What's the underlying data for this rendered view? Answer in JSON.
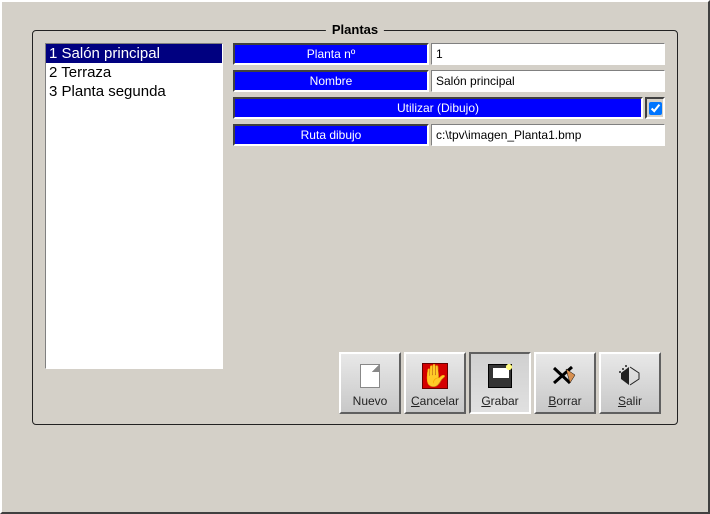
{
  "window": {
    "title": "Plantas"
  },
  "list": {
    "items": [
      {
        "label": "1 Salón principal",
        "selected": true
      },
      {
        "label": "2 Terraza",
        "selected": false
      },
      {
        "label": "3 Planta segunda",
        "selected": false
      }
    ]
  },
  "form": {
    "planta_no": {
      "label": "Planta nº",
      "value": "1"
    },
    "nombre": {
      "label": "Nombre",
      "value": "Salón principal"
    },
    "utilizar": {
      "label": "Utilizar (Dibujo)",
      "checked": true
    },
    "ruta": {
      "label": "Ruta dibujo",
      "value": "c:\\tpv\\imagen_Planta1.bmp"
    }
  },
  "buttons": {
    "nuevo": "Nuevo",
    "cancelar": "Cancelar",
    "grabar": "Grabar",
    "borrar": "Borrar",
    "salir": "Salir"
  }
}
